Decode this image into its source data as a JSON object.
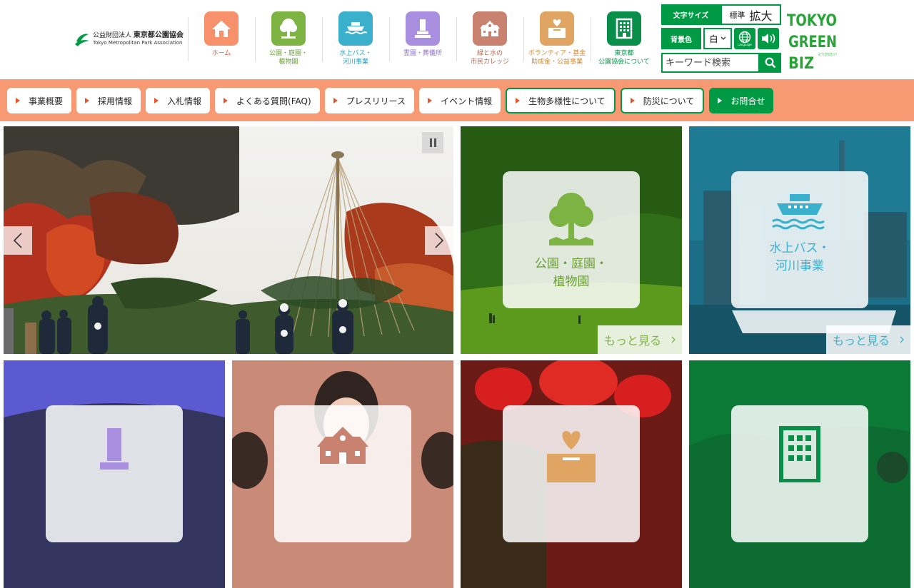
{
  "header": {
    "logo": {
      "line1_prefix": "公益財団法人",
      "line1_name": "東京都公園協会",
      "line2": "Tokyo Metropolitan Park Association"
    },
    "nav": [
      {
        "label": "ホーム",
        "icon": "home-icon",
        "color": "#f7916b"
      },
      {
        "label": "公園・庭園・\n植物園",
        "icon": "tree-icon",
        "color": "#7cb342"
      },
      {
        "label": "水上バス・\n河川事業",
        "icon": "ship-icon",
        "color": "#3bb0cd"
      },
      {
        "label": "霊園・葬儀所",
        "icon": "grave-icon",
        "color": "#a98fe0"
      },
      {
        "label": "緑と水の\n市民カレッジ",
        "icon": "school-icon",
        "color": "#c9826f"
      },
      {
        "label": "ボランティア・基金\n助成金・公益事業",
        "icon": "donation-box-icon",
        "color": "#e0a463"
      },
      {
        "label": "東京都\n公園協会について",
        "icon": "building-icon",
        "color": "#0a8f4a"
      }
    ],
    "utility": {
      "font_size_label": "文字サイズ",
      "font_standard": "標準",
      "font_large": "拡大",
      "bg_label": "背景色",
      "bg_value": "白",
      "language_label": "Language",
      "search_placeholder": "キーワード検索"
    },
    "tgb": {
      "l1": "TOKYO",
      "l2": "GREEN",
      "l3": "BIZ",
      "tag": "みどりと生きるまちづくり"
    }
  },
  "subnav": [
    {
      "label": "事業概要",
      "style": "plain"
    },
    {
      "label": "採用情報",
      "style": "plain"
    },
    {
      "label": "入札情報",
      "style": "plain"
    },
    {
      "label": "よくある質問(FAQ)",
      "style": "plain"
    },
    {
      "label": "プレスリリース",
      "style": "plain"
    },
    {
      "label": "イベント情報",
      "style": "plain"
    },
    {
      "label": "生物多様性について",
      "style": "green-border"
    },
    {
      "label": "防災について",
      "style": "green-border"
    },
    {
      "label": "お問合せ",
      "style": "green-fill"
    }
  ],
  "tiles": [
    {
      "label": "公園・庭園・\n植物園",
      "more": "もっと見る",
      "icon": "tree-icon",
      "color": "#7cb342"
    },
    {
      "label": "水上バス・\n河川事業",
      "more": "もっと見る",
      "icon": "ship-icon",
      "color": "#3bb0cd"
    },
    {
      "label": "",
      "icon": "grave-icon",
      "color": "#a98fe0"
    },
    {
      "label": "",
      "icon": "school-icon",
      "color": "#c9826f"
    },
    {
      "label": "",
      "icon": "donation-box-icon",
      "color": "#e0a463"
    },
    {
      "label": "",
      "icon": "building-icon",
      "color": "#0a8f4a"
    }
  ]
}
